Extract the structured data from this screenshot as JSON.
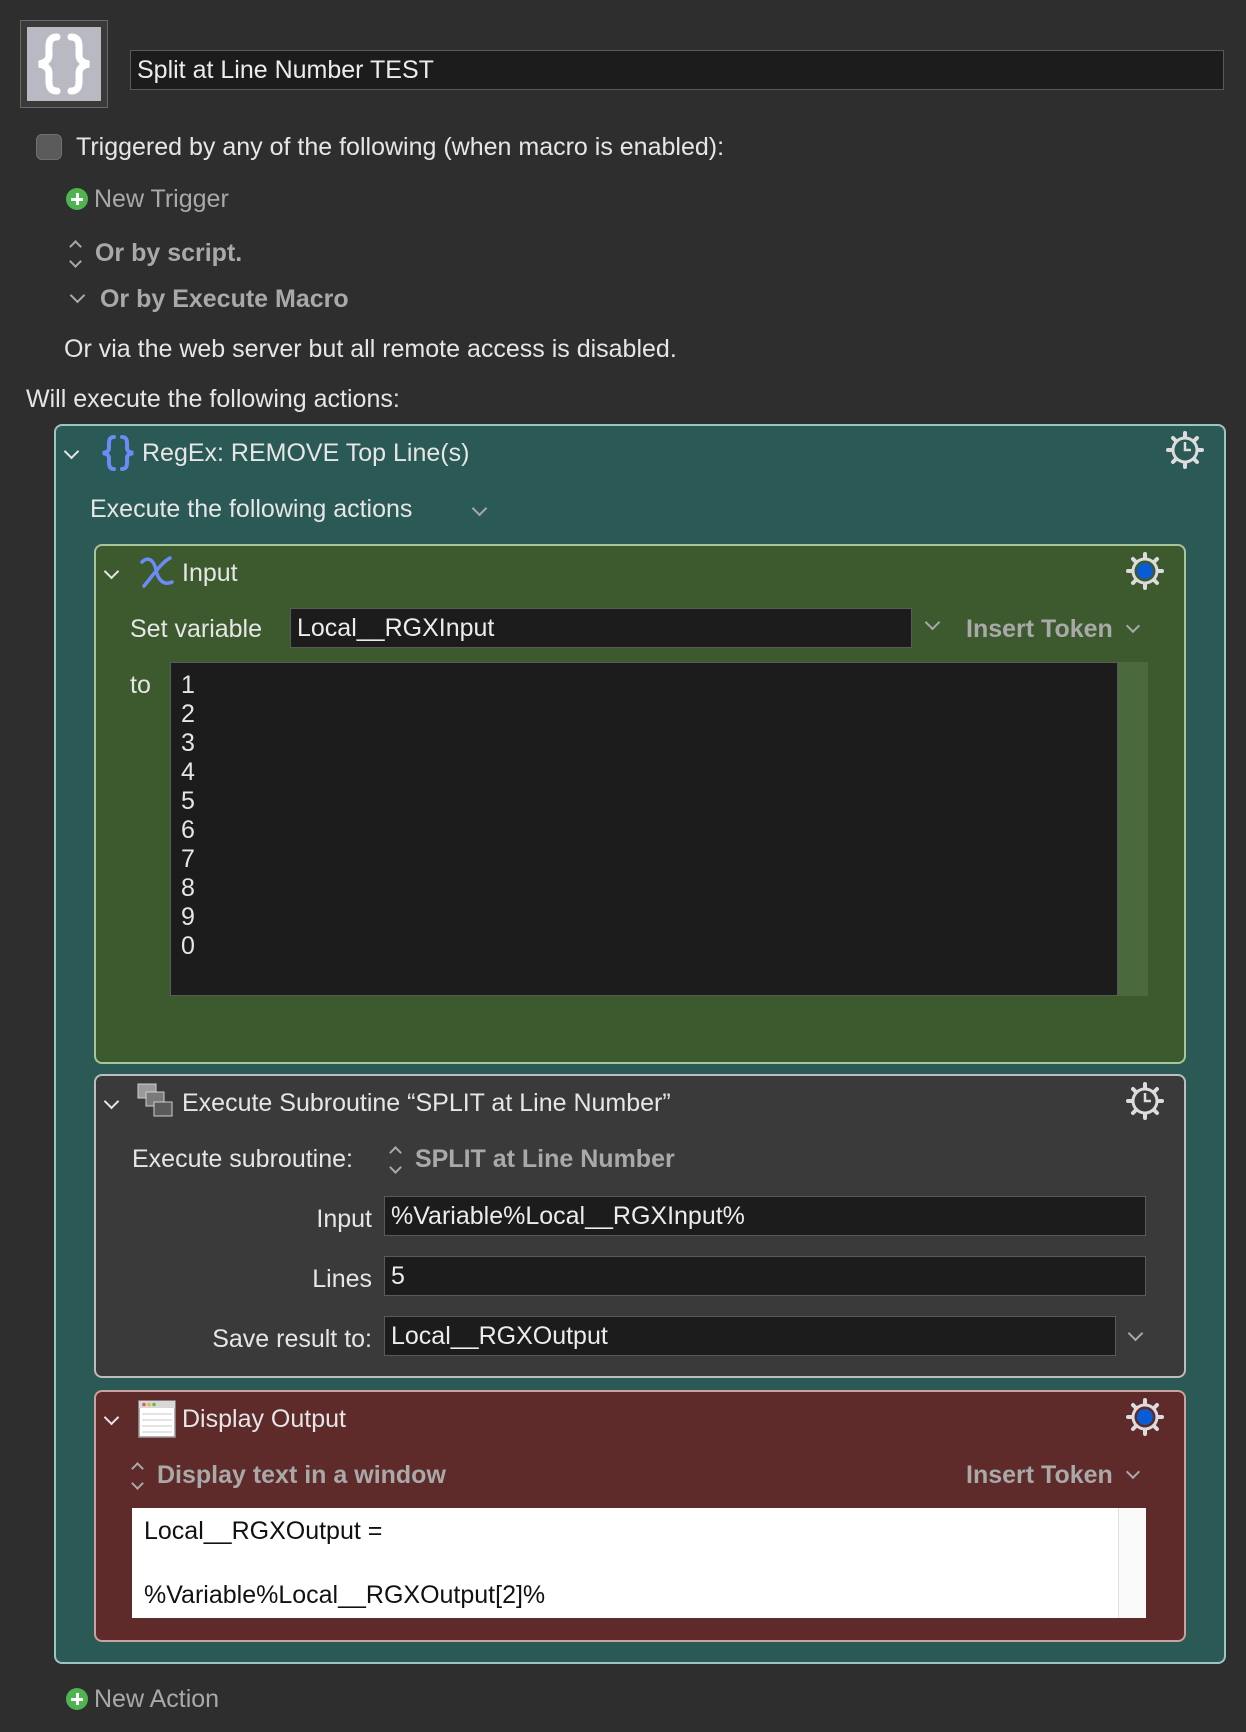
{
  "macro": {
    "name": "Split at Line Number TEST",
    "icon": "curly-braces-icon"
  },
  "triggers": {
    "heading": "Triggered by any of the following (when macro is enabled):",
    "new_trigger": "New Trigger",
    "by_script": "Or by script.",
    "by_execute_macro": "Or by Execute Macro",
    "web_server": "Or via the web server but all remote access is disabled."
  },
  "actions_heading": "Will execute the following actions:",
  "group": {
    "title": "RegEx: REMOVE Top Line(s)",
    "execute_label": "Execute the following actions",
    "color": "#2b5955"
  },
  "set_variable": {
    "title": "Input",
    "set_label": "Set variable",
    "variable": "Local__RGXInput",
    "insert_token": "Insert Token",
    "to_label": "to",
    "lines": [
      "1",
      "2",
      "3",
      "4",
      "5",
      "6",
      "7",
      "8",
      "9",
      "0"
    ],
    "color": "#3d5a2e"
  },
  "subroutine": {
    "title": "Execute Subroutine “SPLIT at Line Number”",
    "execute_label": "Execute subroutine:",
    "subroutine_name": "SPLIT at Line Number",
    "input_label": "Input",
    "input_value": "%Variable%Local__RGXInput%",
    "lines_label": "Lines",
    "lines_value": "5",
    "save_label": "Save result to:",
    "save_value": "Local__RGXOutput",
    "color": "#3a3a3a"
  },
  "display": {
    "title": "Display Output",
    "mode": "Display text in a window",
    "insert_token": "Insert Token",
    "text_line1": "Local__RGXOutput =",
    "text_line2": "%Variable%Local__RGXOutput[2]%",
    "color": "#5e2a2a"
  },
  "new_action": "New Action"
}
